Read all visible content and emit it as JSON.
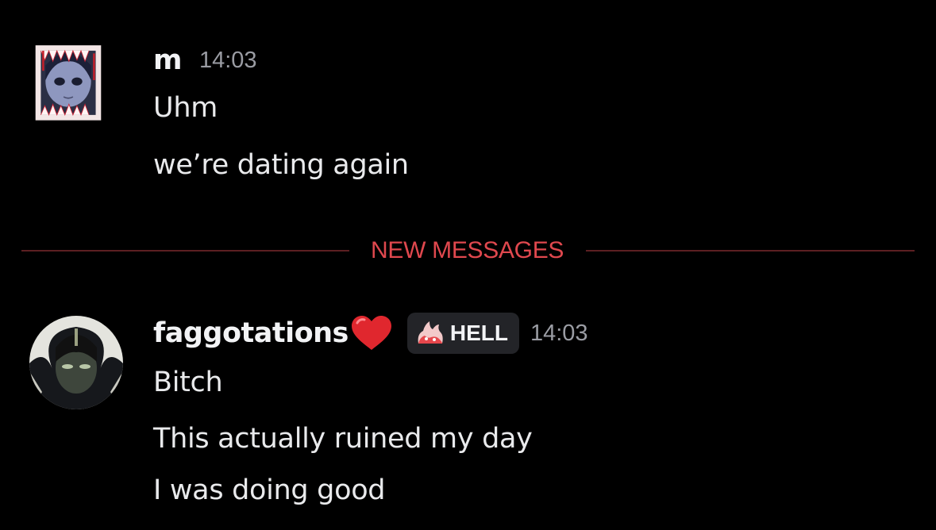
{
  "messages": [
    {
      "author": "m",
      "timestamp": "14:03",
      "avatar_icon": "anime-girl-teeth-frame-avatar",
      "lines": [
        "Uhm",
        "we’re dating again"
      ]
    },
    {
      "author": "faggotations",
      "author_emoji": "red-heart-icon",
      "role_tag": {
        "icon": "fire-hand-icon",
        "label": "HELL"
      },
      "timestamp": "14:03",
      "avatar_icon": "anime-boy-dark-avatar",
      "lines": [
        "Bitch",
        "This actually ruined my day",
        "I was doing good"
      ]
    }
  ],
  "divider": {
    "label": "NEW MESSAGES"
  },
  "colors": {
    "background": "#000000",
    "divider_accent": "#e0484e",
    "divider_line": "#5c1f22",
    "role_tag_bg": "#232428",
    "timestamp": "#9a9ca3"
  }
}
